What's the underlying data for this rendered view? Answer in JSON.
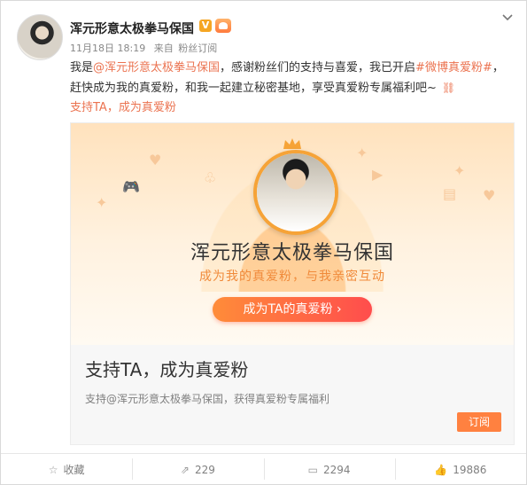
{
  "header": {
    "author": "浑元形意太极拳马保国",
    "time": "11月18日 18:19",
    "source_prefix": "来自",
    "source": "粉丝订阅"
  },
  "post": {
    "text_1": "我是",
    "mention": "@浑元形意太极拳马保国",
    "text_2": "，感谢粉丝们的支持与喜爱，我已开启",
    "hashtag": "#微博真爱粉#",
    "text_3": "，赶快成为我的真爱粉，和我一起建立秘密基地，享受真爱粉专属福利吧~",
    "link": "支持TA，成为真爱粉"
  },
  "banner": {
    "name": "浑元形意太极拳马保国",
    "subtitle": "成为我的真爱粉，与我亲密互动",
    "button": "成为TA的真爱粉 ›"
  },
  "embed": {
    "title": "支持TA，成为真爱粉",
    "description": "支持@浑元形意太极拳马保国，获得真爱粉专属福利",
    "subscribe_label": "订阅"
  },
  "footer": {
    "favorite_label": "收藏",
    "repost_count": "229",
    "comment_count": "2294",
    "like_count": "19886"
  },
  "icons": {
    "verified": "verified-v-icon",
    "fan": "fan-badge-icon",
    "menu": "chevron-down-icon",
    "link": "link-icon",
    "favorite": "star-icon",
    "repost": "repost-icon",
    "comment": "comment-icon",
    "like": "thumbs-up-icon"
  },
  "colors": {
    "accent": "#eb7350",
    "subscribe": "#ff8140",
    "banner_button_start": "#ff8c39",
    "banner_button_end": "#ff4d4d"
  }
}
